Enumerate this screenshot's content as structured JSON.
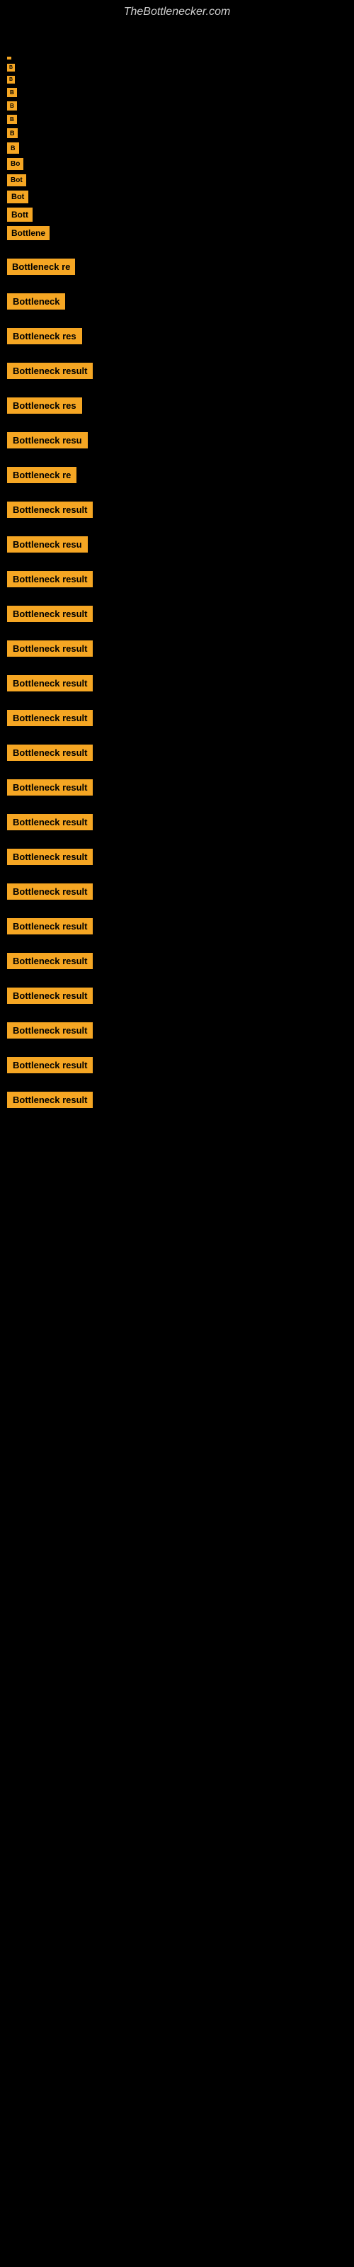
{
  "site": {
    "title": "TheBottlenecker.com"
  },
  "items": [
    {
      "id": 1,
      "label": " "
    },
    {
      "id": 2,
      "label": "B"
    },
    {
      "id": 3,
      "label": "B"
    },
    {
      "id": 4,
      "label": "B"
    },
    {
      "id": 5,
      "label": "B"
    },
    {
      "id": 6,
      "label": "B"
    },
    {
      "id": 7,
      "label": "B"
    },
    {
      "id": 8,
      "label": "B"
    },
    {
      "id": 9,
      "label": "Bo"
    },
    {
      "id": 10,
      "label": "Bot"
    },
    {
      "id": 11,
      "label": "Bot"
    },
    {
      "id": 12,
      "label": "Bott"
    },
    {
      "id": 13,
      "label": "Bottlene"
    },
    {
      "id": 14,
      "label": "Bottleneck re"
    },
    {
      "id": 15,
      "label": "Bottleneck"
    },
    {
      "id": 16,
      "label": "Bottleneck res"
    },
    {
      "id": 17,
      "label": "Bottleneck result"
    },
    {
      "id": 18,
      "label": "Bottleneck res"
    },
    {
      "id": 19,
      "label": "Bottleneck resu"
    },
    {
      "id": 20,
      "label": "Bottleneck re"
    },
    {
      "id": 21,
      "label": "Bottleneck result"
    },
    {
      "id": 22,
      "label": "Bottleneck resu"
    },
    {
      "id": 23,
      "label": "Bottleneck result"
    },
    {
      "id": 24,
      "label": "Bottleneck result"
    },
    {
      "id": 25,
      "label": "Bottleneck result"
    },
    {
      "id": 26,
      "label": "Bottleneck result"
    },
    {
      "id": 27,
      "label": "Bottleneck result"
    },
    {
      "id": 28,
      "label": "Bottleneck result"
    },
    {
      "id": 29,
      "label": "Bottleneck result"
    },
    {
      "id": 30,
      "label": "Bottleneck result"
    },
    {
      "id": 31,
      "label": "Bottleneck result"
    },
    {
      "id": 32,
      "label": "Bottleneck result"
    },
    {
      "id": 33,
      "label": "Bottleneck result"
    },
    {
      "id": 34,
      "label": "Bottleneck result"
    },
    {
      "id": 35,
      "label": "Bottleneck result"
    },
    {
      "id": 36,
      "label": "Bottleneck result"
    },
    {
      "id": 37,
      "label": "Bottleneck result"
    },
    {
      "id": 38,
      "label": "Bottleneck result"
    }
  ]
}
